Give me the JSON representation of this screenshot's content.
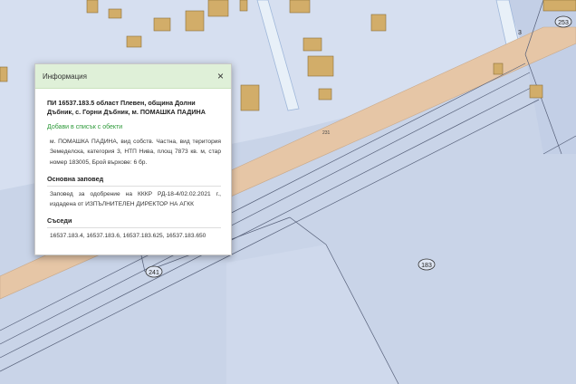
{
  "map": {
    "parcel_labels": [
      "241",
      "183",
      "253",
      "3"
    ],
    "road_label": "231"
  },
  "popup": {
    "header_title": "Информация",
    "close_symbol": "×",
    "parcel_title": "ПИ 16537.183.5 област Плевен, община Долни Дъбник, с. Горни Дъбник, м. ПОМАШКА ПАДИНА",
    "add_link": "Добави в списък с обекти",
    "description": "м. ПОМАШКА ПАДИНА, вид собств. Частна, вид територия Земеделска, категория 3, НТП Нива, площ 7873 кв. м, стар номер 183005, Брой върхове: 6 бр.",
    "order_heading": "Основна заповед",
    "order_text": "Заповед за одобрение на КККР РД-18-4/02.02.2021 г., издадена от ИЗПЪЛНИТЕЛЕН ДИРЕКТОР НА АГКК",
    "neighbors_heading": "Съседи",
    "neighbors_text": "16537.183.4, 16537.183.6, 16537.183.625, 16537.183.650"
  }
}
